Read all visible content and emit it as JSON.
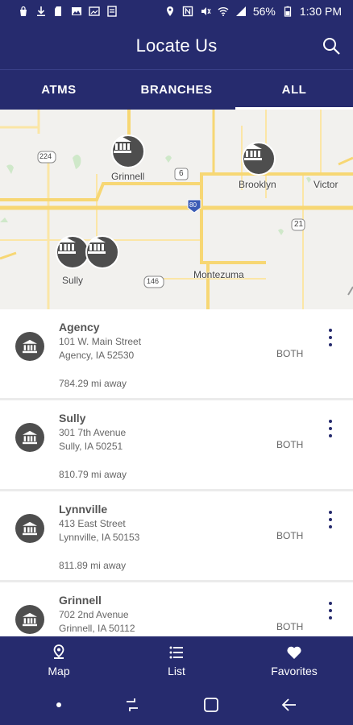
{
  "status_bar": {
    "battery": "56%",
    "time": "1:30 PM"
  },
  "app_bar": {
    "title": "Locate Us"
  },
  "tabs": [
    {
      "label": "ATMS"
    },
    {
      "label": "BRANCHES"
    },
    {
      "label": "ALL"
    }
  ],
  "map": {
    "labels": {
      "grinnell": "Grinnell",
      "brooklyn": "Brooklyn",
      "victor": "Victor",
      "sully": "Sully",
      "montezuma": "Montezuma",
      "hwy_224": "224",
      "hwy_6": "6",
      "hwy_80": "80",
      "hwy_21": "21",
      "hwy_146": "146"
    }
  },
  "locations": [
    {
      "name": "Agency",
      "address1": "101 W. Main Street",
      "address2": "Agency, IA 52530",
      "distance": "784.29 mi away",
      "type": "BOTH"
    },
    {
      "name": "Sully",
      "address1": "301 7th Avenue",
      "address2": "Sully, IA 50251",
      "distance": "810.79 mi away",
      "type": "BOTH"
    },
    {
      "name": "Lynnville",
      "address1": "413 East Street",
      "address2": "Lynnville, IA 50153",
      "distance": "811.89 mi away",
      "type": "BOTH"
    },
    {
      "name": "Grinnell",
      "address1": "702 2nd Avenue",
      "address2": "Grinnell, IA 50112",
      "distance": "",
      "type": "BOTH"
    }
  ],
  "bottom_nav": [
    {
      "label": "Map",
      "icon": "map-pin-icon"
    },
    {
      "label": "List",
      "icon": "list-icon"
    },
    {
      "label": "Favorites",
      "icon": "heart-icon"
    }
  ],
  "colors": {
    "primary": "#262b6e",
    "marker": "#4e4e4e",
    "road": "#f7d774"
  }
}
